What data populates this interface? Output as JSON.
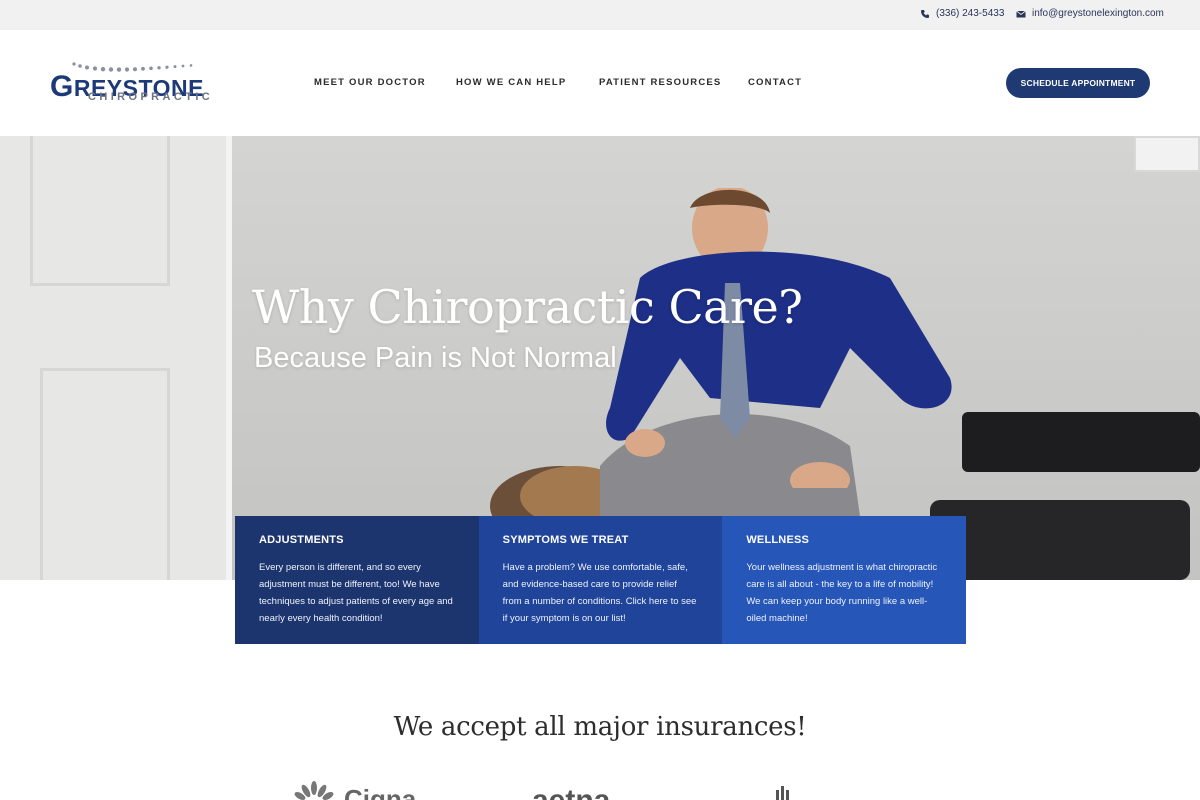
{
  "topbar": {
    "phone": "(336) 243-5433",
    "email": "info@greystonelexington.com",
    "phone_icon": "phone-icon",
    "email_icon": "envelope-icon"
  },
  "logo": {
    "initial": "G",
    "rest": "REYSTONE",
    "sub": "CHIROPRACTIC"
  },
  "nav": {
    "items": [
      "MEET OUR DOCTOR",
      "HOW WE CAN HELP",
      "PATIENT RESOURCES",
      "CONTACT"
    ],
    "cta": "SCHEDULE APPOINTMENT"
  },
  "hero": {
    "title": "Why Chiropractic Care?",
    "subtitle": "Because Pain is Not Normal"
  },
  "cards": [
    {
      "title": "ADJUSTMENTS",
      "body": "Every person is different, and so every adjustment must be different, too! We have techniques to adjust patients of every age and nearly every health condition!"
    },
    {
      "title": "SYMPTOMS WE TREAT",
      "body": "Have a problem? We use comfortable, safe, and evidence-based care to provide relief from a number of conditions. Click here to see if your symptom is on our list!"
    },
    {
      "title": "WELLNESS",
      "body": "Your wellness adjustment is what chiropractic care is all about - the key to a life of mobility! We can keep your body running like a well-oiled machine!"
    }
  ],
  "insurance": {
    "title": "We accept all major insurances!",
    "logos": [
      "Cigna",
      "aetna"
    ]
  },
  "colors": {
    "brand": "#1d3a78",
    "card1": "#1d356e",
    "card2": "#1f449a",
    "card3": "#2656b8"
  }
}
